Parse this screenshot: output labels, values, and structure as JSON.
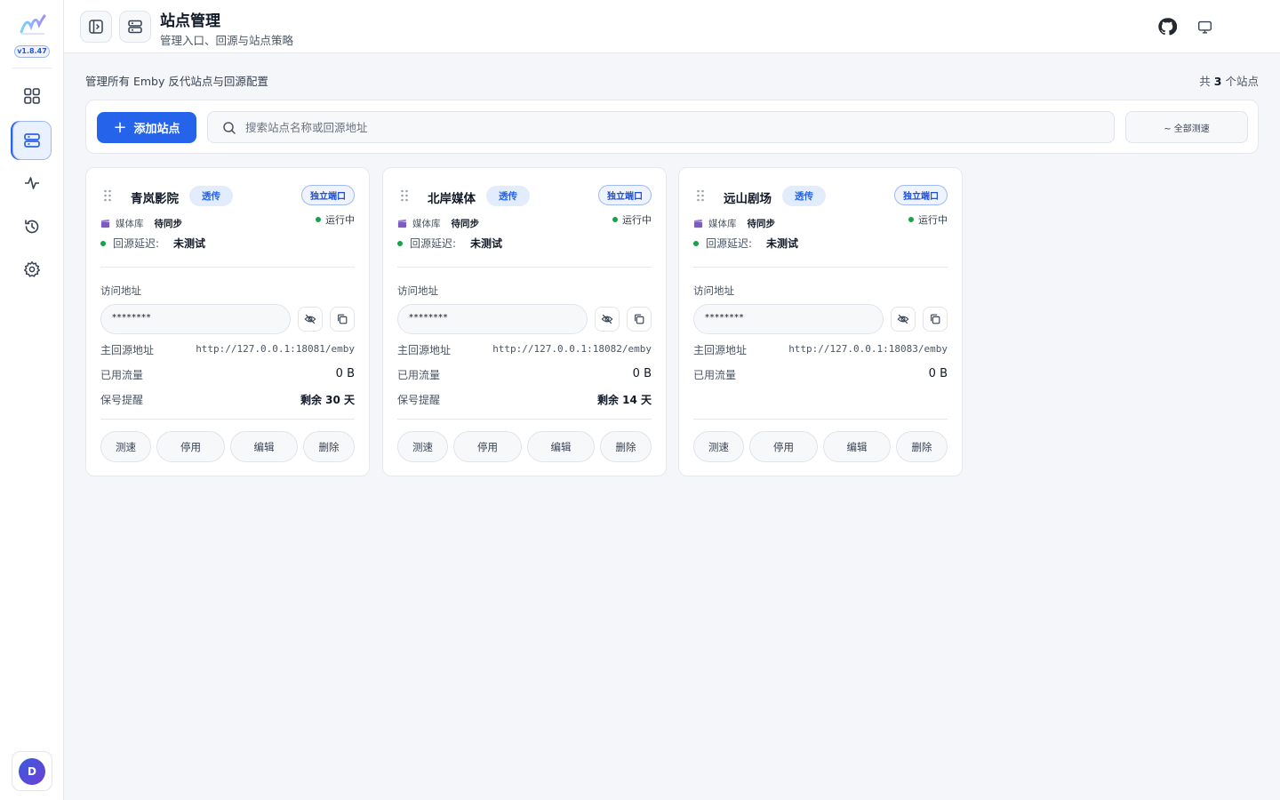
{
  "app": {
    "version": "v1.8.47",
    "user_initial": "D",
    "nav": [
      {
        "icon": "dashboard-icon"
      },
      {
        "icon": "server-icon",
        "active": true
      },
      {
        "icon": "activity-icon"
      },
      {
        "icon": "history-icon"
      },
      {
        "icon": "gear-icon"
      }
    ]
  },
  "header": {
    "title": "站点管理",
    "subtitle": "管理入口、回源与站点策略"
  },
  "main": {
    "description": "管理所有 Emby 反代站点与回源配置",
    "count_prefix": "共",
    "count_value": "3",
    "count_suffix": "个站点"
  },
  "toolbar": {
    "add_label": "添加站点",
    "search_placeholder": "搜索站点名称或回源地址",
    "test_all_label": "~ 全部测速"
  },
  "cards": [
    {
      "name": "青岚影院",
      "mode_tag": "透传",
      "port_tag": "独立端口",
      "status": "运行中",
      "library_label": "媒体库",
      "library_value": "待同步",
      "latency_label": "回源延迟:",
      "latency_value": "未测试",
      "access_label": "访问地址",
      "access_value": "********",
      "origin_label": "主回源地址",
      "origin_value": "http://127.0.0.1:18081/emby",
      "traffic_label": "已用流量",
      "traffic_value": "0 B",
      "keep_label": "保号提醒",
      "keep_value": "剩余 30 天",
      "actions": [
        "测速",
        "停用",
        "编辑",
        "删除"
      ]
    },
    {
      "name": "北岸媒体",
      "mode_tag": "透传",
      "port_tag": "独立端口",
      "status": "运行中",
      "library_label": "媒体库",
      "library_value": "待同步",
      "latency_label": "回源延迟:",
      "latency_value": "未测试",
      "access_label": "访问地址",
      "access_value": "********",
      "origin_label": "主回源地址",
      "origin_value": "http://127.0.0.1:18082/emby",
      "traffic_label": "已用流量",
      "traffic_value": "0 B",
      "keep_label": "保号提醒",
      "keep_value": "剩余 14 天",
      "actions": [
        "测速",
        "停用",
        "编辑",
        "删除"
      ]
    },
    {
      "name": "远山剧场",
      "mode_tag": "透传",
      "port_tag": "独立端口",
      "status": "运行中",
      "library_label": "媒体库",
      "library_value": "待同步",
      "latency_label": "回源延迟:",
      "latency_value": "未测试",
      "access_label": "访问地址",
      "access_value": "********",
      "origin_label": "主回源地址",
      "origin_value": "http://127.0.0.1:18083/emby",
      "traffic_label": "已用流量",
      "traffic_value": "0 B",
      "actions": [
        "测速",
        "停用",
        "编辑",
        "删除"
      ]
    }
  ],
  "colors": {
    "accent": "#2563eb",
    "status_green": "#16a34a",
    "background": "#f5f6f9"
  }
}
